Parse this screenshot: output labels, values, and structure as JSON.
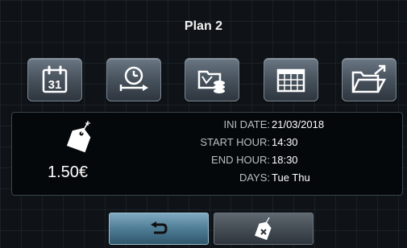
{
  "header": {
    "title": "Plan 2"
  },
  "toolbar": {
    "buttons": [
      {
        "icon": "calendar-31-icon",
        "text": "31"
      },
      {
        "icon": "clock-arrow-icon"
      },
      {
        "icon": "folder-coins-icon"
      },
      {
        "icon": "calendar-grid-icon"
      },
      {
        "icon": "open-folder-icon"
      }
    ]
  },
  "info": {
    "price_icon": "price-tag-icon",
    "price": "1.50€",
    "ini_date_label": "INI DATE:",
    "ini_date": "21/03/2018",
    "start_hour_label": "START HOUR:",
    "start_hour": "14:30",
    "end_hour_label": "END HOUR:",
    "end_hour": "18:30",
    "days_label": "DAYS:",
    "days": "Tue Thu"
  },
  "actions": {
    "back_icon": "back-arrow-icon",
    "delete_icon": "delete-tag-icon"
  },
  "colors": {
    "background": "#101418",
    "panel": "#05080a",
    "back_button": "#4f7d96",
    "delete_button": "#454d55"
  }
}
